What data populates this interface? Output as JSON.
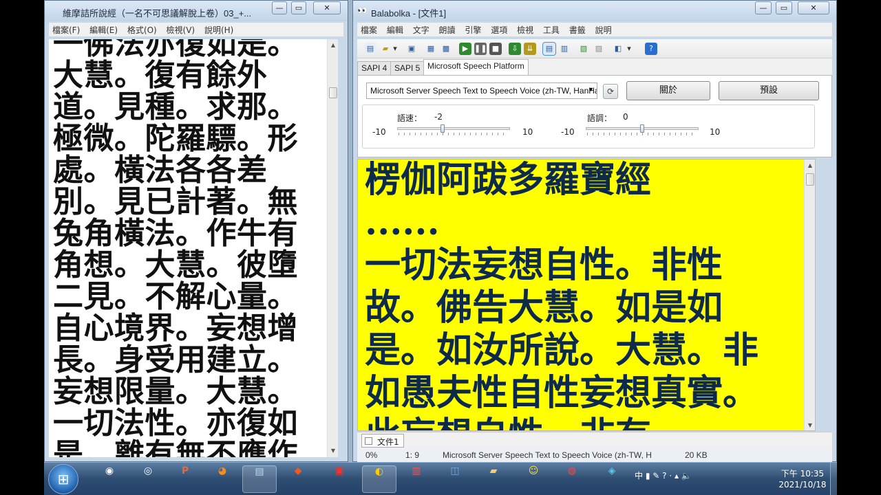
{
  "left_window": {
    "title": "維摩詰所說經（一名不可思議解脫上卷）03_+...",
    "menu": [
      "檔案(F)",
      "編輯(E)",
      "格式(O)",
      "檢視(V)",
      "說明(H)"
    ],
    "text": "一佛法亦復如是。大慧。復有餘外道。見種。求那。極微。陀羅驃。形處。橫法各各差別。見已計著。無兔角橫法。作牛有角想。大慧。彼墮二見。不解心量。自心境界。妄想增長。身受用建立。妄想限量。大慧。一切法性。亦復如是。離有無不應作想"
  },
  "right_window": {
    "title": "Balabolka - [文件1]",
    "menu": [
      "檔案",
      "編輯",
      "文字",
      "朗讀",
      "引擎",
      "選項",
      "檢視",
      "工具",
      "書籤",
      "說明"
    ],
    "toolbar_icons": [
      "new-icon",
      "open-icon",
      "open-dropdown-icon",
      "save-icon",
      "print-icon",
      "print-preview-icon",
      "play-icon",
      "pause-icon",
      "stop-icon",
      "export-icon",
      "export-split-icon",
      "view-text-icon",
      "view-dual-icon",
      "clipboard-icon",
      "spell-icon",
      "voice-icon",
      "voice-dropdown-icon",
      "help-icon"
    ],
    "tabs": [
      "SAPI 4",
      "SAPI 5",
      "Microsoft Speech Platform"
    ],
    "active_tab": "Microsoft Speech Platform",
    "voice": "Microsoft Server Speech Text to Speech Voice (zh-TW, HanHan)",
    "about_label": "關於",
    "defaults_label": "預設",
    "rate": {
      "label": "語速：",
      "value": "-2",
      "min": "-10",
      "max": "10",
      "fraction": 0.4
    },
    "pitch": {
      "label": "語調：",
      "value": "0",
      "min": "-10",
      "max": "10",
      "fraction": 0.5
    },
    "editor_text": "楞伽阿跋多羅寶經\n......\n一切法妄想自性。非性故。佛告大慧。如是如是。如汝所說。大慧。非如愚夫性自性妄想真實。此妄想自性。非有",
    "editor_bg": "#ffff00",
    "editor_fg": "#0d2a4b",
    "doc_tab": "文件1",
    "status": {
      "percent": "0%",
      "position": "1:  9",
      "voice": "Microsoft Server Speech Text to Speech Voice (zh-TW, H",
      "size": "20 KB"
    }
  },
  "taskbar": {
    "apps": [
      "windows-explorer-icon",
      "media-player-icon",
      "powerpoint-icon",
      "firefox-icon",
      "notepad-icon",
      "brave-icon",
      "pdf-icon",
      "balabolka-icon",
      "photos-icon",
      "network-icon",
      "folder-icon",
      "emoji-icon",
      "chrome-icon",
      "app-icon"
    ],
    "ime": "中",
    "time": "下午 10:35",
    "date": "2021/10/18"
  }
}
